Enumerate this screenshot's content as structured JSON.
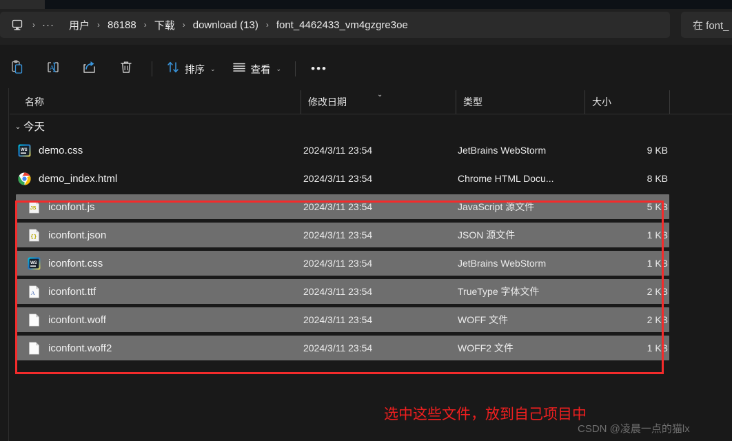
{
  "window": {
    "title": "font_4462433_vm4gzgre3oe"
  },
  "breadcrumb": {
    "pc_icon": "monitor-icon",
    "ellipsis": "···",
    "separator": "›",
    "items": [
      {
        "label": "用户"
      },
      {
        "label": "86188"
      },
      {
        "label": "下载"
      },
      {
        "label": "download (13)"
      },
      {
        "label": "font_4462433_vm4gzgre3oe"
      }
    ]
  },
  "search": {
    "value": "",
    "placeholder": "在 font_"
  },
  "toolbar": {
    "buttons": [
      {
        "name": "paste-button",
        "icon": "paste-icon",
        "label": ""
      },
      {
        "name": "rename-button",
        "icon": "rename-icon",
        "label": ""
      },
      {
        "name": "share-button",
        "icon": "share-icon",
        "label": ""
      },
      {
        "name": "delete-button",
        "icon": "trash-icon",
        "label": ""
      }
    ],
    "sort_label": "排序",
    "view_label": "查看",
    "chevron": "⌄",
    "more_label": "•••"
  },
  "columns": {
    "name": "名称",
    "date": "修改日期",
    "type": "类型",
    "size": "大小",
    "sort_indicator": "⌄"
  },
  "group": {
    "chevron": "⌄",
    "label": "今天"
  },
  "files": [
    {
      "name": "demo.css",
      "icon": "webstorm-icon",
      "date": "2024/3/11 23:54",
      "type": "JetBrains WebStorm",
      "size": "9 KB",
      "selected": false
    },
    {
      "name": "demo_index.html",
      "icon": "chrome-icon",
      "date": "2024/3/11 23:54",
      "type": "Chrome HTML Docu...",
      "size": "8 KB",
      "selected": false
    },
    {
      "name": "iconfont.js",
      "icon": "js-file-icon",
      "date": "2024/3/11 23:54",
      "type": "JavaScript 源文件",
      "size": "5 KB",
      "selected": true
    },
    {
      "name": "iconfont.json",
      "icon": "json-file-icon",
      "date": "2024/3/11 23:54",
      "type": "JSON 源文件",
      "size": "1 KB",
      "selected": true
    },
    {
      "name": "iconfont.css",
      "icon": "webstorm-icon",
      "date": "2024/3/11 23:54",
      "type": "JetBrains WebStorm",
      "size": "1 KB",
      "selected": true
    },
    {
      "name": "iconfont.ttf",
      "icon": "ttf-file-icon",
      "date": "2024/3/11 23:54",
      "type": "TrueType 字体文件",
      "size": "2 KB",
      "selected": true
    },
    {
      "name": "iconfont.woff",
      "icon": "blank-file-icon",
      "date": "2024/3/11 23:54",
      "type": "WOFF 文件",
      "size": "2 KB",
      "selected": true
    },
    {
      "name": "iconfont.woff2",
      "icon": "blank-file-icon",
      "date": "2024/3/11 23:54",
      "type": "WOFF2 文件",
      "size": "1 KB",
      "selected": true
    }
  ],
  "annotation": {
    "text": "选中这些文件，放到自己项目中",
    "color": "#f01f1f",
    "watermark": "CSDN @凌晨一点的猫lx"
  },
  "colors": {
    "background": "#191919",
    "selection": "#6e6e6e",
    "accent": "#3a96dd",
    "annotation_red": "#f42b2b"
  }
}
